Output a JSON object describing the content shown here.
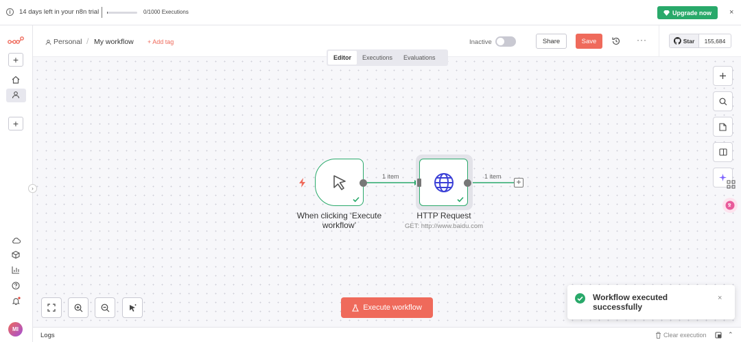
{
  "banner": {
    "trial_text": "14 days left in your n8n trial",
    "executions_text": "0/1000 Executions",
    "executions_progress": 0.03,
    "upgrade_label": "Upgrade now",
    "close_symbol": "×"
  },
  "header": {
    "project": "Personal",
    "workflow_name": "My workflow",
    "add_tag": "+ Add tag",
    "active_state": "Inactive",
    "share_label": "Share",
    "save_label": "Save",
    "github_star_label": "Star",
    "github_star_count": "155,684"
  },
  "tabs": [
    {
      "label": "Editor",
      "active": true
    },
    {
      "label": "Executions",
      "active": false
    },
    {
      "label": "Evaluations",
      "active": false
    }
  ],
  "nodes": {
    "trigger": {
      "label": "When clicking ‘Execute workflow’",
      "status": "success"
    },
    "http": {
      "label": "HTTP Request",
      "subtitle": "GET: http://www.baidu.com",
      "status": "success"
    }
  },
  "edges": {
    "trigger_to_http": "1 item",
    "http_to_end": "1 item"
  },
  "canvas": {
    "execute_label": "Execute workflow"
  },
  "toast": {
    "message": "Workflow executed successfully",
    "close_symbol": "×"
  },
  "logs": {
    "title": "Logs",
    "clear_label": "Clear execution"
  },
  "sidebar": {
    "avatar_initials": "MI"
  },
  "colors": {
    "brand": "#ef6a5b",
    "success": "#29a96a",
    "upgrade": "#29a96a"
  }
}
